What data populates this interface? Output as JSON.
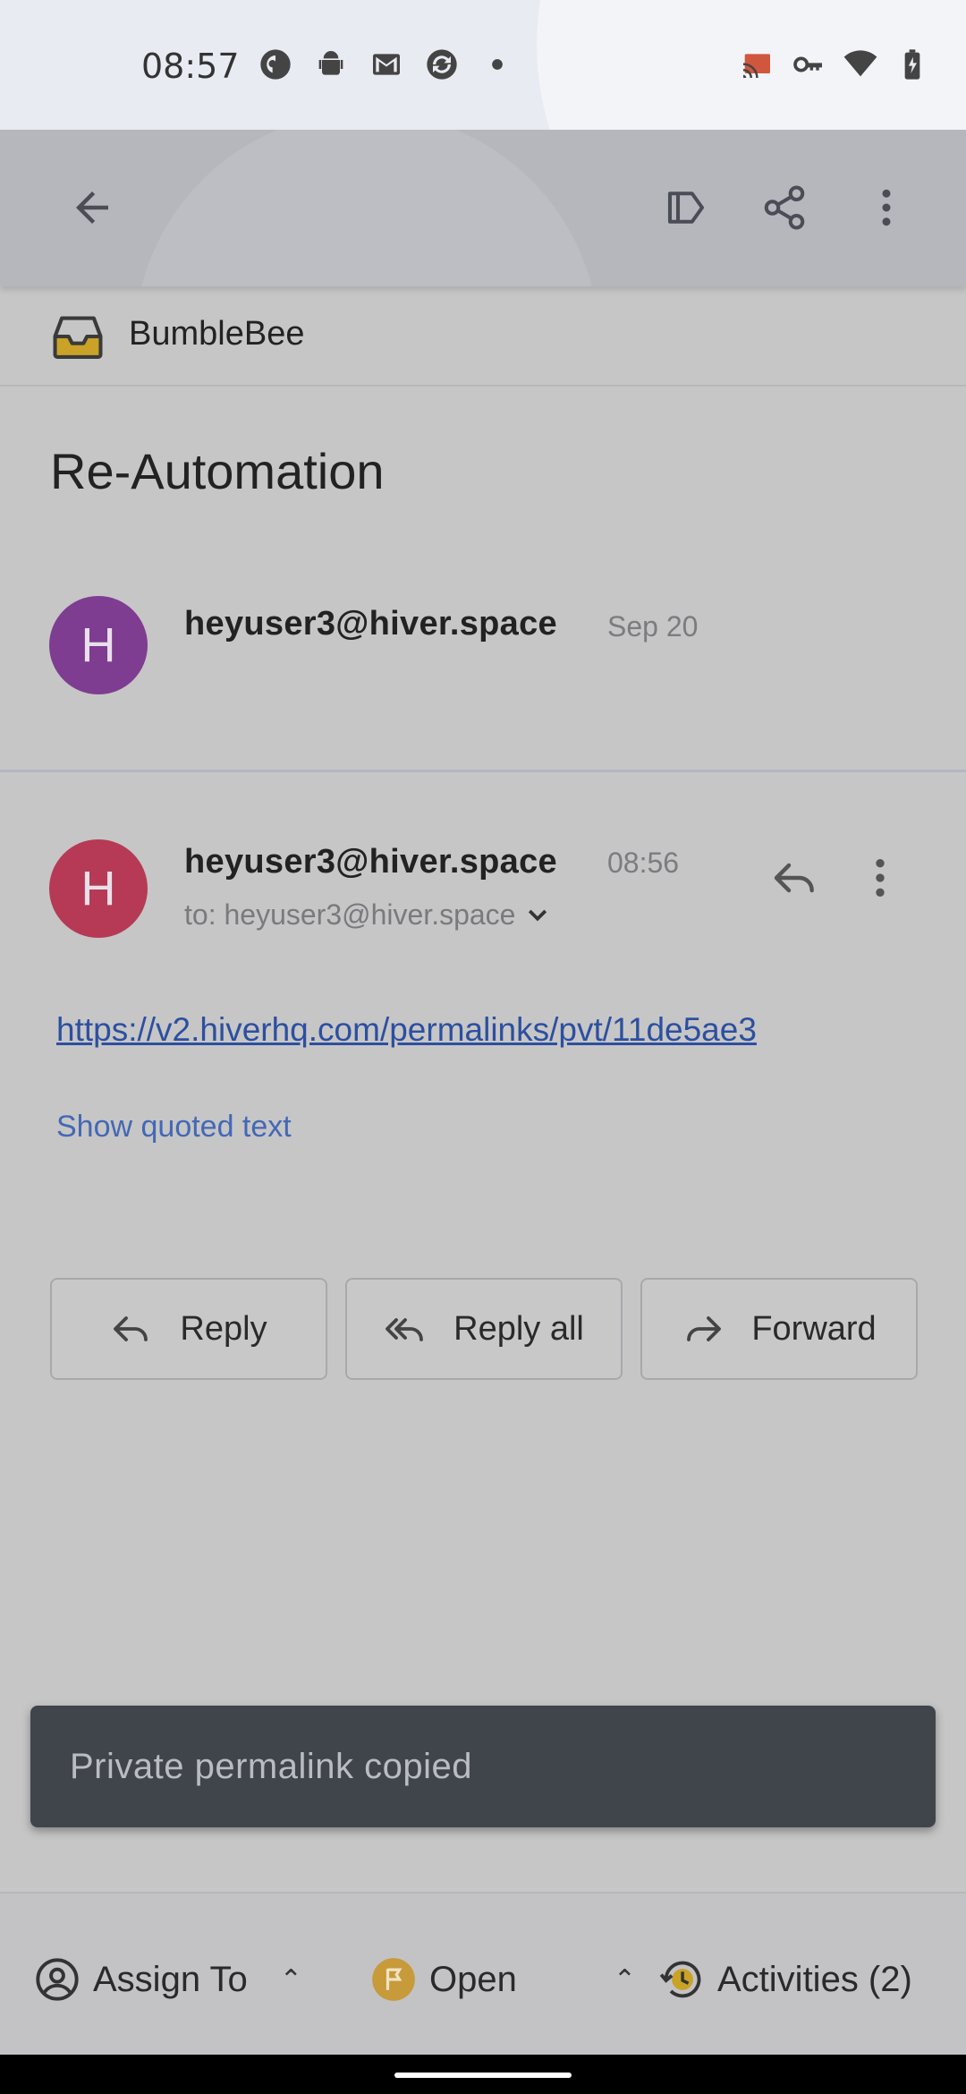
{
  "status_bar": {
    "time": "08:57",
    "left_icons": [
      "pocket-casts-icon",
      "android-icon",
      "gmail-icon",
      "sync-app-icon",
      "dot-icon"
    ],
    "right_icons": [
      "cast-icon",
      "vpn-key-icon",
      "wifi-icon",
      "battery-charging-icon"
    ]
  },
  "toolbar": {
    "icons": [
      "back-arrow-icon",
      "label-icon",
      "share-icon",
      "more-vert-icon"
    ]
  },
  "inbox": {
    "name": "BumbleBee",
    "icon": "inbox-tray-icon",
    "icon_color": "#c9a227"
  },
  "thread": {
    "subject": "Re-Automation"
  },
  "messages": [
    {
      "avatar_letter": "H",
      "avatar_color": "#7e3d91",
      "sender": "heyuser3@hiver.space",
      "date": "Sep 20"
    },
    {
      "avatar_letter": "H",
      "avatar_color": "#b63a55",
      "sender": "heyuser3@hiver.space",
      "date": "08:56",
      "to": "to: heyuser3@hiver.space",
      "body_link": "https://v2.hiverhq.com/permalinks/pvt/11de5ae3",
      "show_quoted_label": "Show quoted text"
    }
  ],
  "actions": {
    "reply": "Reply",
    "reply_all": "Reply all",
    "forward": "Forward"
  },
  "snackbar": {
    "message": "Private permalink copied"
  },
  "bottom_bar": {
    "assign_label": "Assign To",
    "status_label": "Open",
    "status_color": "#c79a3a",
    "activities_label": "Activities (2)"
  },
  "colors": {
    "link": "#2d4fa0",
    "snackbar_bg": "#40444b"
  }
}
